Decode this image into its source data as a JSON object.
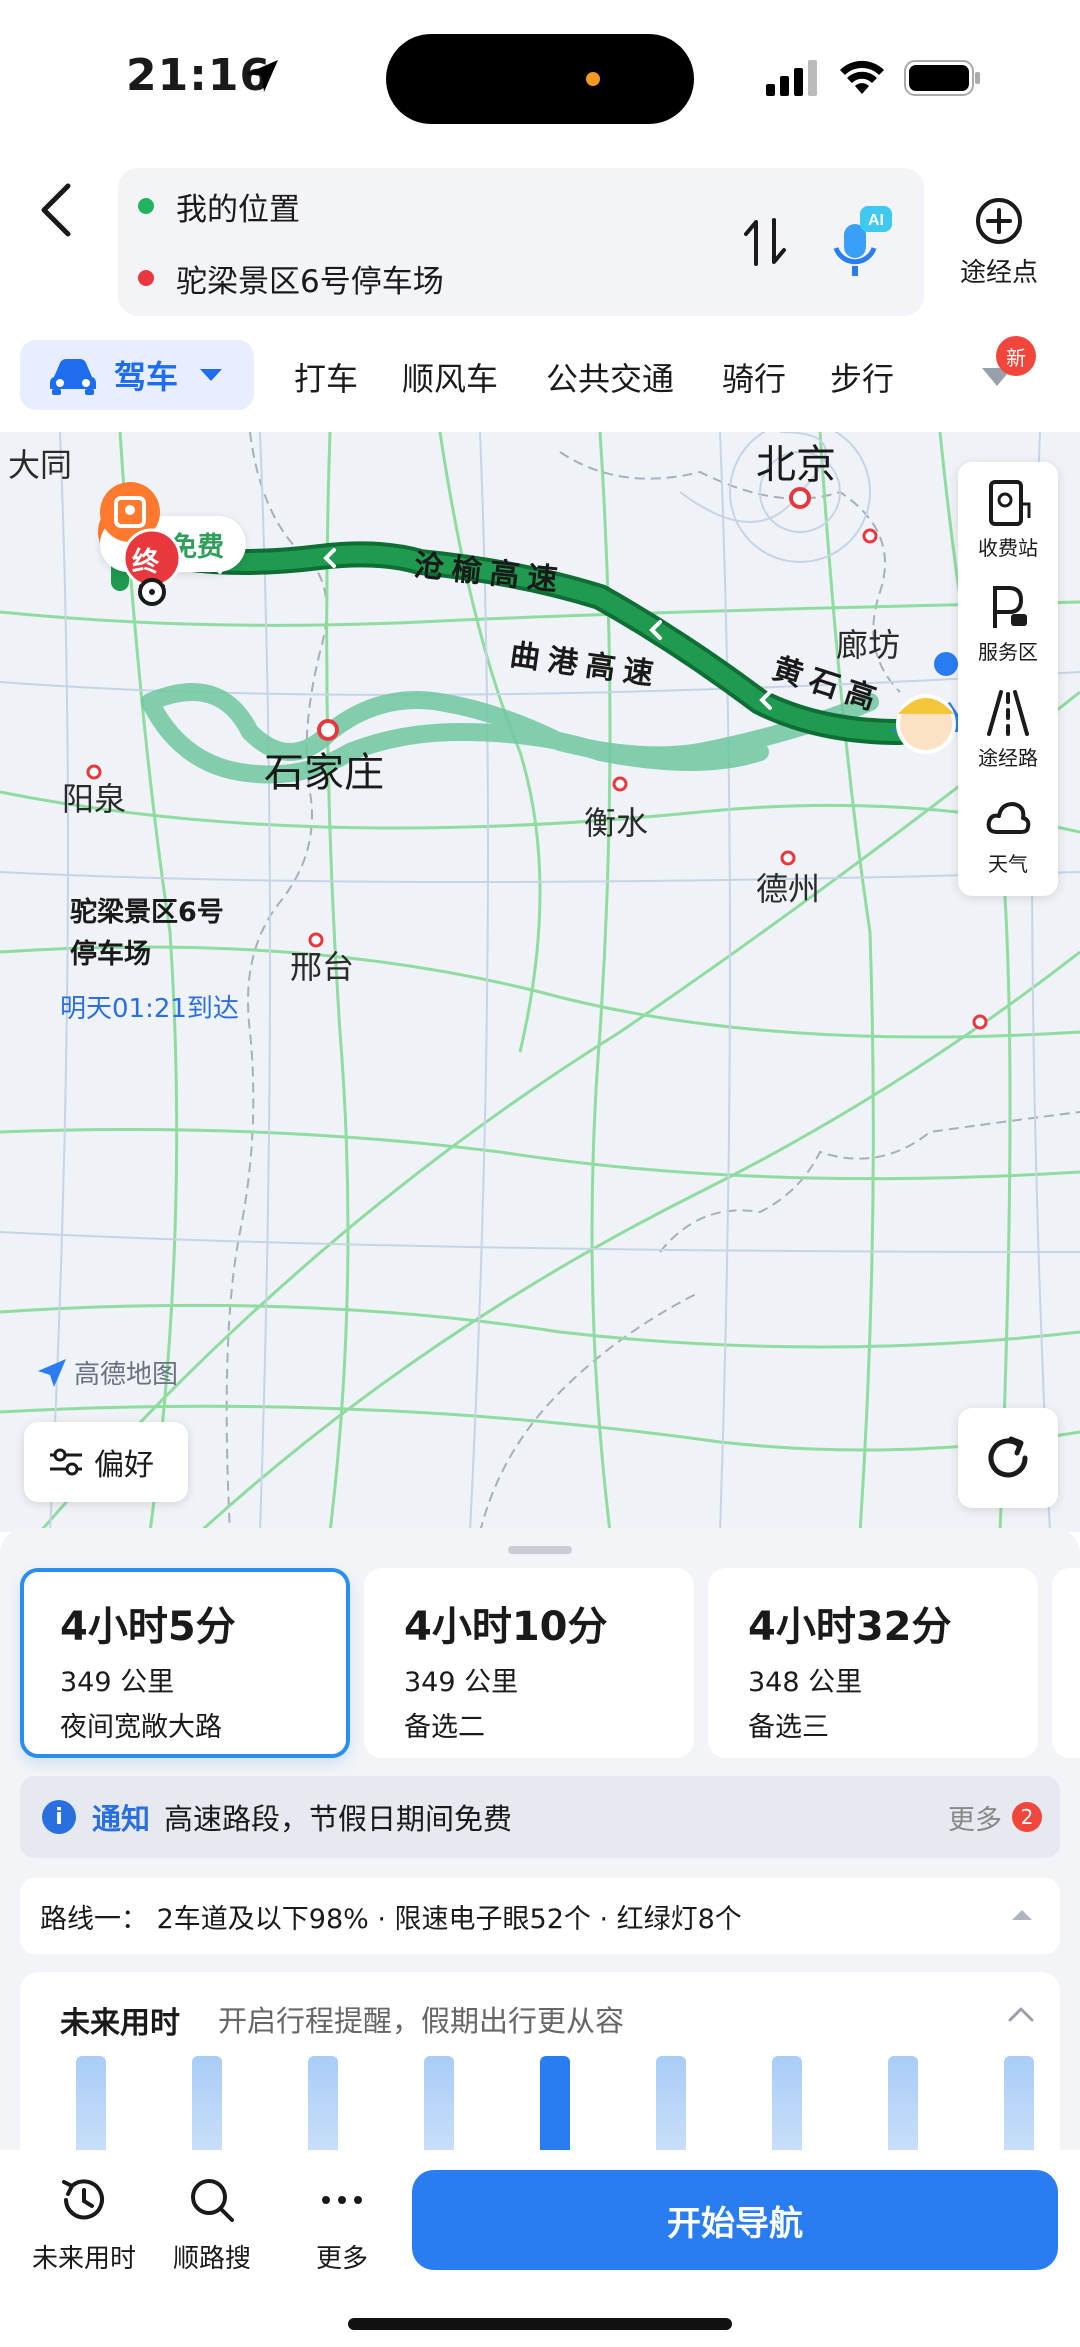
{
  "status_bar": {
    "time": "21:16"
  },
  "route": {
    "origin": "我的位置",
    "destination": "驼梁景区6号停车场",
    "add_stop_label": "途经点"
  },
  "modes": {
    "active": "驾车",
    "items": [
      "打车",
      "顺风车",
      "公共交通",
      "骑行",
      "步行"
    ],
    "more_badge": "新"
  },
  "map": {
    "cities": {
      "datong": "大同",
      "beijing": "北京",
      "langfang": "廊坊",
      "shijiazhuang": "石家庄",
      "yangquan": "阳泉",
      "hengshui": "衡水",
      "dezhou": "德州",
      "xingtai": "邢台"
    },
    "roads": {
      "r1": "沧榆高速",
      "r2": "曲港高速",
      "r3": "黄石高"
    },
    "free_tag": "免费",
    "end_marker": "终",
    "destination_name_line1": "驼梁景区6号",
    "destination_name_line2": "停车场",
    "eta": "明天01:21到达",
    "logo": "高德地图",
    "tools": [
      "收费站",
      "服务区",
      "途经路",
      "天气"
    ],
    "preference_label": "偏好",
    "colors": {
      "main_route": "#1f9a4f",
      "alt_route": "#6fc8a0"
    }
  },
  "route_options": [
    {
      "duration": "4小时5分",
      "distance": "349 公里",
      "tag": "夜间宽敞大路"
    },
    {
      "duration": "4小时10分",
      "distance": "349 公里",
      "tag": "备选二"
    },
    {
      "duration": "4小时32分",
      "distance": "348 公里",
      "tag": "备选三"
    }
  ],
  "notice": {
    "title": "通知",
    "text": "高速路段，节假日期间免费",
    "more": "更多",
    "count": "2"
  },
  "route_info": "路线一：  2车道及以下98% · 限速电子眼52个 · 红绿灯8个",
  "future": {
    "title": "未来用时",
    "subtitle": "开启行程提醒，假期出行更从容"
  },
  "bottom": {
    "future_time": "未来用时",
    "search_along": "顺路搜",
    "more": "更多",
    "start_nav": "开始导航"
  }
}
